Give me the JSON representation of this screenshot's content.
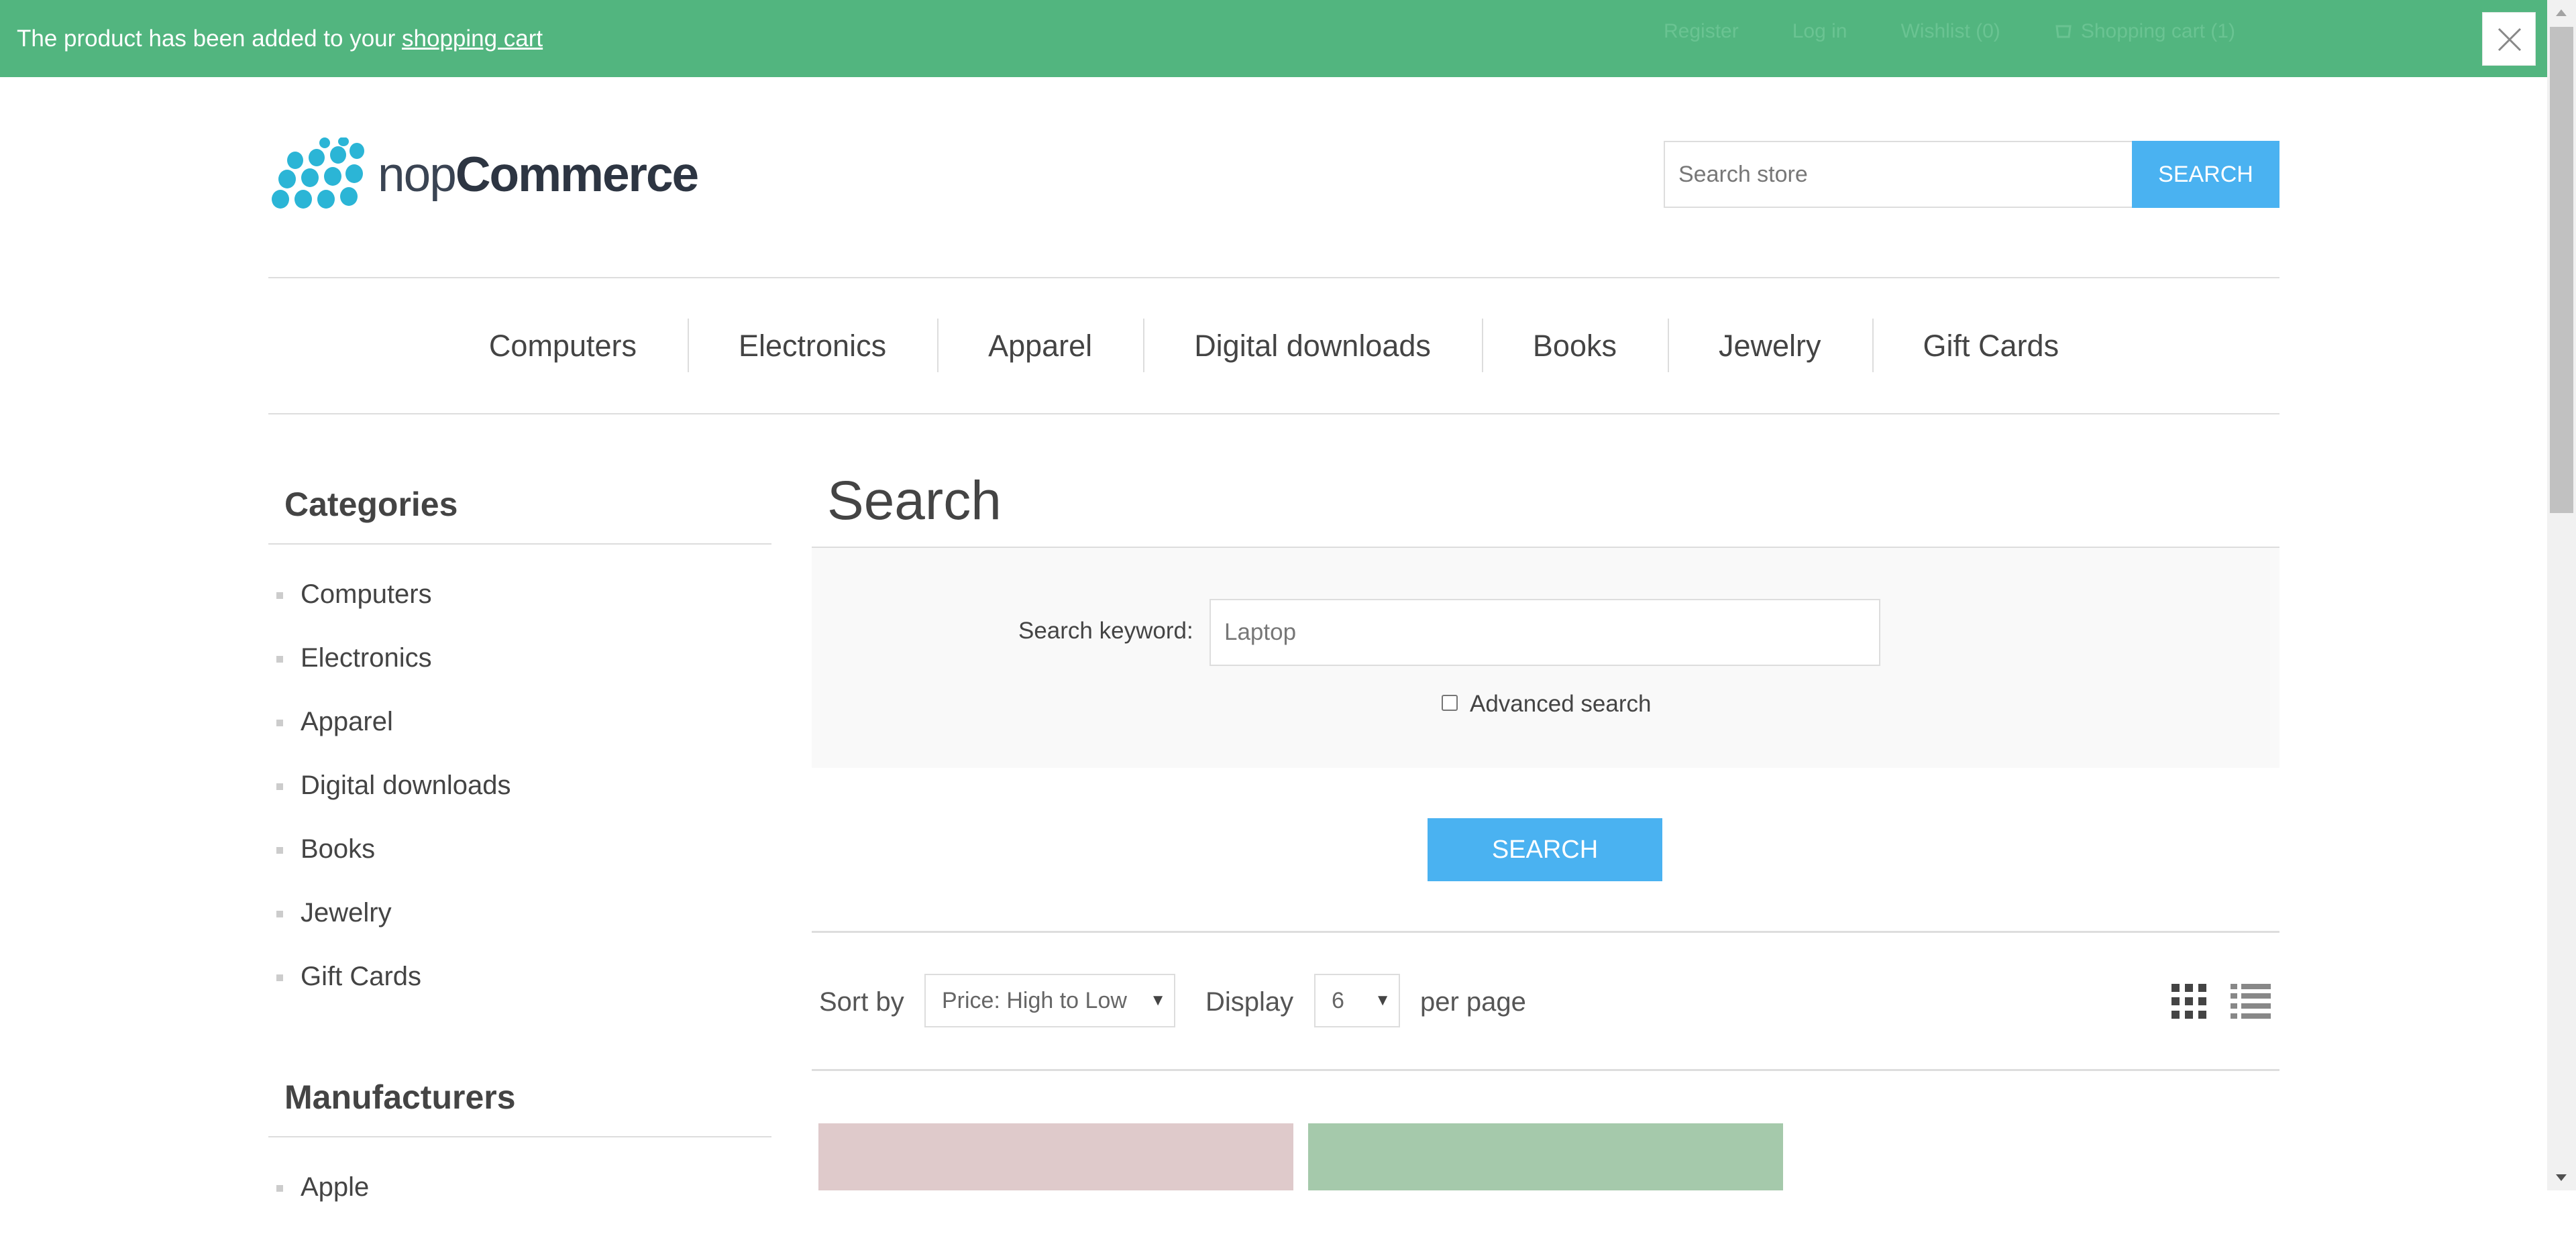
{
  "notification": {
    "prefix": "The product has been added to your ",
    "link": "shopping cart"
  },
  "header_links": {
    "register": "Register",
    "login": "Log in",
    "wishlist": "Wishlist (0)",
    "cart": "Shopping cart (1)"
  },
  "logo": {
    "thin": "nop",
    "bold": "Commerce",
    "color": "#2bb5d6"
  },
  "search": {
    "placeholder": "Search store",
    "button": "SEARCH"
  },
  "top_menu": [
    "Computers",
    "Electronics",
    "Apparel",
    "Digital downloads",
    "Books",
    "Jewelry",
    "Gift Cards"
  ],
  "sidebar": {
    "categories_title": "Categories",
    "categories": [
      "Computers",
      "Electronics",
      "Apparel",
      "Digital downloads",
      "Books",
      "Jewelry",
      "Gift Cards"
    ],
    "manufacturers_title": "Manufacturers",
    "manufacturers": [
      "Apple"
    ]
  },
  "main": {
    "title": "Search",
    "keyword_label": "Search keyword:",
    "keyword_value": "Laptop",
    "advanced_label": "Advanced search",
    "search_button": "SEARCH",
    "sort_label": "Sort by",
    "sort_value": "Price: High to Low",
    "display_label": "Display",
    "display_value": "6",
    "per_page_label": "per page"
  },
  "colors": {
    "notice_bar": "#52b57f",
    "accent_button": "#4ab2f1",
    "product1": "#dfcacb",
    "product2": "#a5c9ab"
  }
}
